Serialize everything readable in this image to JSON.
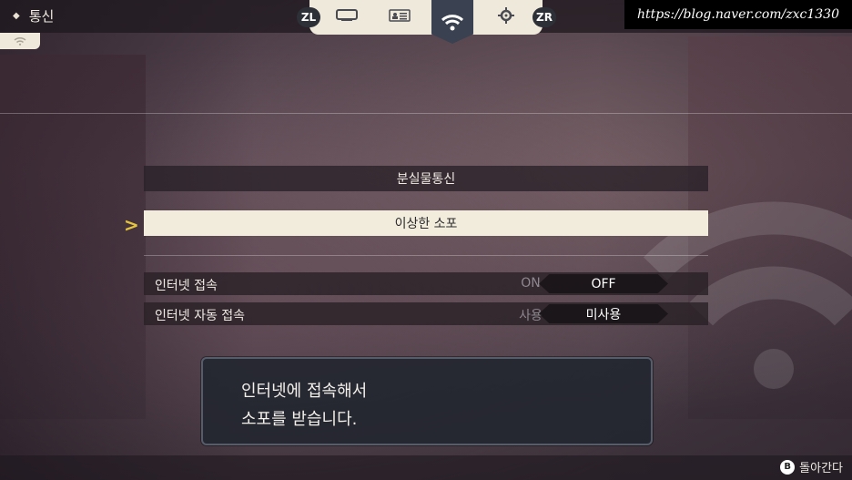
{
  "header": {
    "title": "통신",
    "watermark": "https://blog.naver.com/zxc1330"
  },
  "tabs": {
    "zl_label": "ZL",
    "zr_label": "ZR",
    "items": [
      {
        "icon": "screen-icon"
      },
      {
        "icon": "profile-card-icon"
      },
      {
        "icon": "wifi-icon",
        "active": true
      },
      {
        "icon": "gear-icon"
      }
    ]
  },
  "menu": {
    "items": [
      {
        "label": "분실물통신"
      },
      {
        "label": "이상한 소포",
        "selected": true
      }
    ]
  },
  "options": [
    {
      "label": "인터넷 접속",
      "off_value": "ON",
      "selected_value": "OFF"
    },
    {
      "label": "인터넷 자동 접속",
      "off_value": "사용",
      "selected_value": "미사용"
    }
  ],
  "dialog": {
    "line1": "인터넷에 접속해서",
    "line2": "소포를 받습니다."
  },
  "footer": {
    "button": "B",
    "back_label": "돌아간다"
  },
  "colors": {
    "accent": "#e2c440",
    "selected_bg": "#f1ecdc",
    "active_tab": "#3a4150"
  }
}
